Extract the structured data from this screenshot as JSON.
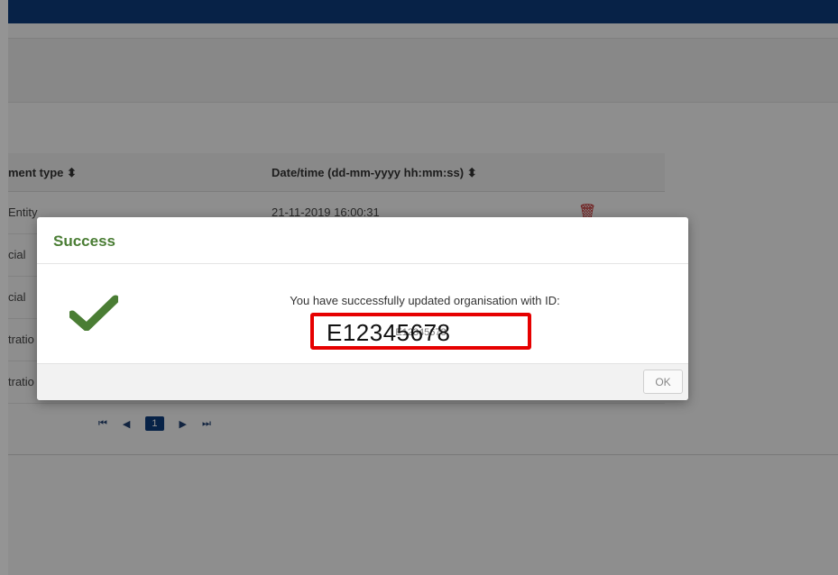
{
  "table": {
    "headers": [
      "ment type ⬍",
      "Date/time (dd-mm-yyyy hh:mm:ss) ⬍"
    ],
    "rows": [
      {
        "type": "Entity",
        "datetime": "21-11-2019 16:00:31"
      },
      {
        "type": "cial",
        "datetime": ""
      },
      {
        "type": "cial",
        "datetime": ""
      },
      {
        "type": "tratio",
        "datetime": ""
      },
      {
        "type": "tratio",
        "datetime": ""
      }
    ]
  },
  "pagination": {
    "first": "⏮",
    "prev": "◀",
    "page": "1",
    "next": "▶",
    "last": "⏭"
  },
  "modal": {
    "title": "Success",
    "message": "You have successfully updated organisation with ID:",
    "id_obscured": "E12345678",
    "ok_label": "OK"
  },
  "annotation": {
    "id_highlight": "E12345678",
    "highlight_color": "#e60000"
  },
  "colors": {
    "header_bar": "#0d3b7a",
    "success_green": "#4a7d34",
    "page_active": "#0d3b7a"
  }
}
